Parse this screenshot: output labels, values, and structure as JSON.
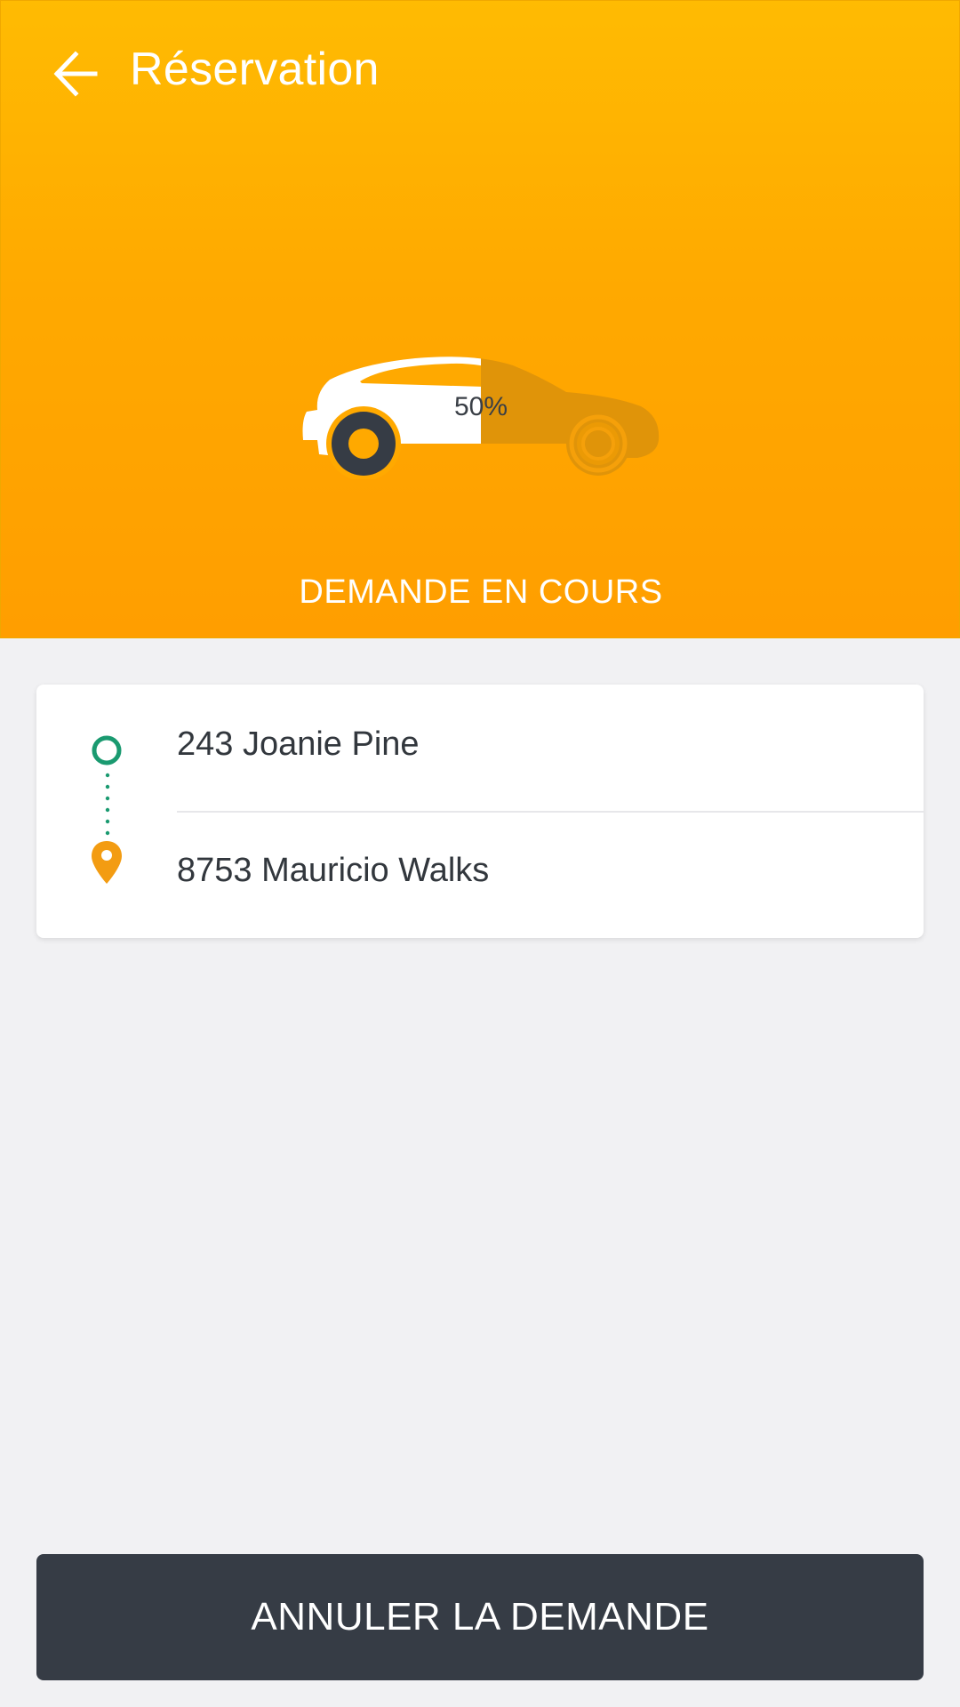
{
  "header": {
    "back_icon": "arrow-left-icon",
    "title": "Réservation",
    "gradient_top": "#ffbb02",
    "gradient_bottom": "#ff9e00"
  },
  "progress": {
    "icon": "car-icon",
    "percent": 50,
    "label": "50%"
  },
  "status": {
    "text": "DEMANDE EN COURS"
  },
  "route": {
    "origin_icon": "origin-circle-icon",
    "origin_color": "#1a9a70",
    "origin": "243 Joanie Pine",
    "destination_icon": "map-pin-icon",
    "destination_color": "#f39c12",
    "destination": "8753 Mauricio Walks"
  },
  "actions": {
    "cancel_label": "ANNULER LA DEMANDE",
    "cancel_color": "#363c45"
  }
}
